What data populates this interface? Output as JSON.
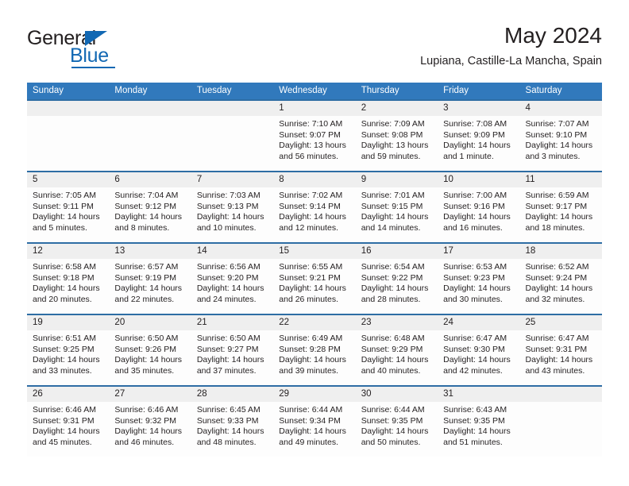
{
  "brand": {
    "name_part1": "General",
    "name_part2": "Blue",
    "color_dark": "#231f20",
    "color_blue": "#1268b3"
  },
  "header": {
    "month_title": "May 2024",
    "location": "Lupiana, Castille-La Mancha, Spain"
  },
  "theme": {
    "header_blue": "#3179bc",
    "separator_blue": "#2e6da4",
    "daynum_band": "#efefef"
  },
  "weekdays": [
    "Sunday",
    "Monday",
    "Tuesday",
    "Wednesday",
    "Thursday",
    "Friday",
    "Saturday"
  ],
  "weeks": [
    [
      {
        "day": "",
        "sunrise": "",
        "sunset": "",
        "daylight": ""
      },
      {
        "day": "",
        "sunrise": "",
        "sunset": "",
        "daylight": ""
      },
      {
        "day": "",
        "sunrise": "",
        "sunset": "",
        "daylight": ""
      },
      {
        "day": "1",
        "sunrise": "Sunrise: 7:10 AM",
        "sunset": "Sunset: 9:07 PM",
        "daylight": "Daylight: 13 hours and 56 minutes."
      },
      {
        "day": "2",
        "sunrise": "Sunrise: 7:09 AM",
        "sunset": "Sunset: 9:08 PM",
        "daylight": "Daylight: 13 hours and 59 minutes."
      },
      {
        "day": "3",
        "sunrise": "Sunrise: 7:08 AM",
        "sunset": "Sunset: 9:09 PM",
        "daylight": "Daylight: 14 hours and 1 minute."
      },
      {
        "day": "4",
        "sunrise": "Sunrise: 7:07 AM",
        "sunset": "Sunset: 9:10 PM",
        "daylight": "Daylight: 14 hours and 3 minutes."
      }
    ],
    [
      {
        "day": "5",
        "sunrise": "Sunrise: 7:05 AM",
        "sunset": "Sunset: 9:11 PM",
        "daylight": "Daylight: 14 hours and 5 minutes."
      },
      {
        "day": "6",
        "sunrise": "Sunrise: 7:04 AM",
        "sunset": "Sunset: 9:12 PM",
        "daylight": "Daylight: 14 hours and 8 minutes."
      },
      {
        "day": "7",
        "sunrise": "Sunrise: 7:03 AM",
        "sunset": "Sunset: 9:13 PM",
        "daylight": "Daylight: 14 hours and 10 minutes."
      },
      {
        "day": "8",
        "sunrise": "Sunrise: 7:02 AM",
        "sunset": "Sunset: 9:14 PM",
        "daylight": "Daylight: 14 hours and 12 minutes."
      },
      {
        "day": "9",
        "sunrise": "Sunrise: 7:01 AM",
        "sunset": "Sunset: 9:15 PM",
        "daylight": "Daylight: 14 hours and 14 minutes."
      },
      {
        "day": "10",
        "sunrise": "Sunrise: 7:00 AM",
        "sunset": "Sunset: 9:16 PM",
        "daylight": "Daylight: 14 hours and 16 minutes."
      },
      {
        "day": "11",
        "sunrise": "Sunrise: 6:59 AM",
        "sunset": "Sunset: 9:17 PM",
        "daylight": "Daylight: 14 hours and 18 minutes."
      }
    ],
    [
      {
        "day": "12",
        "sunrise": "Sunrise: 6:58 AM",
        "sunset": "Sunset: 9:18 PM",
        "daylight": "Daylight: 14 hours and 20 minutes."
      },
      {
        "day": "13",
        "sunrise": "Sunrise: 6:57 AM",
        "sunset": "Sunset: 9:19 PM",
        "daylight": "Daylight: 14 hours and 22 minutes."
      },
      {
        "day": "14",
        "sunrise": "Sunrise: 6:56 AM",
        "sunset": "Sunset: 9:20 PM",
        "daylight": "Daylight: 14 hours and 24 minutes."
      },
      {
        "day": "15",
        "sunrise": "Sunrise: 6:55 AM",
        "sunset": "Sunset: 9:21 PM",
        "daylight": "Daylight: 14 hours and 26 minutes."
      },
      {
        "day": "16",
        "sunrise": "Sunrise: 6:54 AM",
        "sunset": "Sunset: 9:22 PM",
        "daylight": "Daylight: 14 hours and 28 minutes."
      },
      {
        "day": "17",
        "sunrise": "Sunrise: 6:53 AM",
        "sunset": "Sunset: 9:23 PM",
        "daylight": "Daylight: 14 hours and 30 minutes."
      },
      {
        "day": "18",
        "sunrise": "Sunrise: 6:52 AM",
        "sunset": "Sunset: 9:24 PM",
        "daylight": "Daylight: 14 hours and 32 minutes."
      }
    ],
    [
      {
        "day": "19",
        "sunrise": "Sunrise: 6:51 AM",
        "sunset": "Sunset: 9:25 PM",
        "daylight": "Daylight: 14 hours and 33 minutes."
      },
      {
        "day": "20",
        "sunrise": "Sunrise: 6:50 AM",
        "sunset": "Sunset: 9:26 PM",
        "daylight": "Daylight: 14 hours and 35 minutes."
      },
      {
        "day": "21",
        "sunrise": "Sunrise: 6:50 AM",
        "sunset": "Sunset: 9:27 PM",
        "daylight": "Daylight: 14 hours and 37 minutes."
      },
      {
        "day": "22",
        "sunrise": "Sunrise: 6:49 AM",
        "sunset": "Sunset: 9:28 PM",
        "daylight": "Daylight: 14 hours and 39 minutes."
      },
      {
        "day": "23",
        "sunrise": "Sunrise: 6:48 AM",
        "sunset": "Sunset: 9:29 PM",
        "daylight": "Daylight: 14 hours and 40 minutes."
      },
      {
        "day": "24",
        "sunrise": "Sunrise: 6:47 AM",
        "sunset": "Sunset: 9:30 PM",
        "daylight": "Daylight: 14 hours and 42 minutes."
      },
      {
        "day": "25",
        "sunrise": "Sunrise: 6:47 AM",
        "sunset": "Sunset: 9:31 PM",
        "daylight": "Daylight: 14 hours and 43 minutes."
      }
    ],
    [
      {
        "day": "26",
        "sunrise": "Sunrise: 6:46 AM",
        "sunset": "Sunset: 9:31 PM",
        "daylight": "Daylight: 14 hours and 45 minutes."
      },
      {
        "day": "27",
        "sunrise": "Sunrise: 6:46 AM",
        "sunset": "Sunset: 9:32 PM",
        "daylight": "Daylight: 14 hours and 46 minutes."
      },
      {
        "day": "28",
        "sunrise": "Sunrise: 6:45 AM",
        "sunset": "Sunset: 9:33 PM",
        "daylight": "Daylight: 14 hours and 48 minutes."
      },
      {
        "day": "29",
        "sunrise": "Sunrise: 6:44 AM",
        "sunset": "Sunset: 9:34 PM",
        "daylight": "Daylight: 14 hours and 49 minutes."
      },
      {
        "day": "30",
        "sunrise": "Sunrise: 6:44 AM",
        "sunset": "Sunset: 9:35 PM",
        "daylight": "Daylight: 14 hours and 50 minutes."
      },
      {
        "day": "31",
        "sunrise": "Sunrise: 6:43 AM",
        "sunset": "Sunset: 9:35 PM",
        "daylight": "Daylight: 14 hours and 51 minutes."
      },
      {
        "day": "",
        "sunrise": "",
        "sunset": "",
        "daylight": ""
      }
    ]
  ]
}
